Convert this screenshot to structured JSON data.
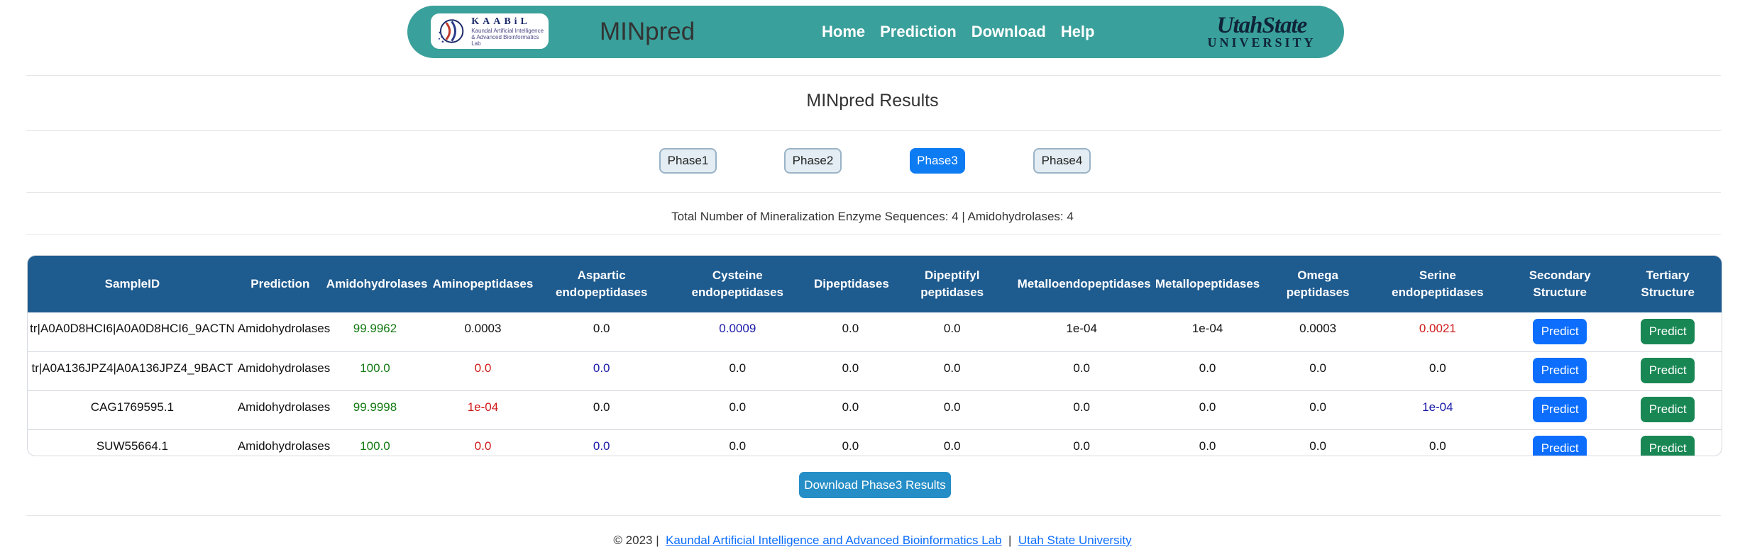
{
  "header": {
    "logo": {
      "title": "KAABiL",
      "subtitle_line1": "Kaundal Artificial Intelligence",
      "subtitle_line2": "& Advanced Bioinformatics Lab"
    },
    "app_title": "MINpred",
    "nav": [
      "Home",
      "Prediction",
      "Download",
      "Help"
    ],
    "university": {
      "top": "UtahState",
      "bottom": "UNIVERSITY"
    }
  },
  "results_title": "MINpred Results",
  "phases": [
    {
      "label": "Phase1",
      "active": false
    },
    {
      "label": "Phase2",
      "active": false
    },
    {
      "label": "Phase3",
      "active": true
    },
    {
      "label": "Phase4",
      "active": false
    }
  ],
  "summary": "Total Number of Mineralization Enzyme Sequences: 4 | Amidohydrolases: 4",
  "table": {
    "headers": [
      [
        "SampleID"
      ],
      [
        "Prediction"
      ],
      [
        "Amidohydrolases"
      ],
      [
        "Aminopeptidases"
      ],
      [
        "Aspartic",
        "endopeptidases"
      ],
      [
        "Cysteine",
        "endopeptidases"
      ],
      [
        "Dipeptidases"
      ],
      [
        "Dipeptifyl",
        "peptidases"
      ],
      [
        "Metalloendopeptidases"
      ],
      [
        "Metallopeptidases"
      ],
      [
        "Omega",
        "peptidases"
      ],
      [
        "Serine",
        "endopeptidases"
      ],
      [
        "Secondary",
        "Structure"
      ],
      [
        "Tertiary",
        "Structure"
      ]
    ],
    "rows": [
      {
        "sample_id": "tr|A0A0D8HCI6|A0A0D8HCI6_9ACTN",
        "prediction": "Amidohydrolases",
        "values": [
          {
            "v": "99.9962",
            "c": "green"
          },
          {
            "v": "0.0003",
            "c": "black"
          },
          {
            "v": "0.0",
            "c": "black"
          },
          {
            "v": "0.0009",
            "c": "blue"
          },
          {
            "v": "0.0",
            "c": "black"
          },
          {
            "v": "0.0",
            "c": "black"
          },
          {
            "v": "1e-04",
            "c": "black"
          },
          {
            "v": "1e-04",
            "c": "black"
          },
          {
            "v": "0.0003",
            "c": "black"
          },
          {
            "v": "0.0021",
            "c": "red"
          }
        ],
        "secondary": "Predict",
        "tertiary": "Predict"
      },
      {
        "sample_id": "tr|A0A136JPZ4|A0A136JPZ4_9BACT",
        "prediction": "Amidohydrolases",
        "values": [
          {
            "v": "100.0",
            "c": "green"
          },
          {
            "v": "0.0",
            "c": "red"
          },
          {
            "v": "0.0",
            "c": "blue"
          },
          {
            "v": "0.0",
            "c": "black"
          },
          {
            "v": "0.0",
            "c": "black"
          },
          {
            "v": "0.0",
            "c": "black"
          },
          {
            "v": "0.0",
            "c": "black"
          },
          {
            "v": "0.0",
            "c": "black"
          },
          {
            "v": "0.0",
            "c": "black"
          },
          {
            "v": "0.0",
            "c": "black"
          }
        ],
        "secondary": "Predict",
        "tertiary": "Predict"
      },
      {
        "sample_id": "CAG1769595.1",
        "prediction": "Amidohydrolases",
        "values": [
          {
            "v": "99.9998",
            "c": "green"
          },
          {
            "v": "1e-04",
            "c": "red"
          },
          {
            "v": "0.0",
            "c": "black"
          },
          {
            "v": "0.0",
            "c": "black"
          },
          {
            "v": "0.0",
            "c": "black"
          },
          {
            "v": "0.0",
            "c": "black"
          },
          {
            "v": "0.0",
            "c": "black"
          },
          {
            "v": "0.0",
            "c": "black"
          },
          {
            "v": "0.0",
            "c": "black"
          },
          {
            "v": "1e-04",
            "c": "blue"
          }
        ],
        "secondary": "Predict",
        "tertiary": "Predict"
      },
      {
        "sample_id": "SUW55664.1",
        "prediction": "Amidohydrolases",
        "values": [
          {
            "v": "100.0",
            "c": "green"
          },
          {
            "v": "0.0",
            "c": "red"
          },
          {
            "v": "0.0",
            "c": "blue"
          },
          {
            "v": "0.0",
            "c": "black"
          },
          {
            "v": "0.0",
            "c": "black"
          },
          {
            "v": "0.0",
            "c": "black"
          },
          {
            "v": "0.0",
            "c": "black"
          },
          {
            "v": "0.0",
            "c": "black"
          },
          {
            "v": "0.0",
            "c": "black"
          },
          {
            "v": "0.0",
            "c": "black"
          }
        ],
        "secondary": "Predict",
        "tertiary": "Predict"
      }
    ]
  },
  "download_button": "Download Phase3 Results",
  "footer": {
    "copyright": "© 2023 |",
    "lab_link": "Kaundal Artificial Intelligence and Advanced Bioinformatics Lab",
    "separator": "|",
    "university_link": "Utah State University"
  },
  "colors": {
    "navbar": "#3aa09b",
    "table_header": "#1e5b8f",
    "phase_active": "#0d7cf2",
    "predict_secondary": "#0d6efd",
    "predict_tertiary": "#198754",
    "download": "#268ec7"
  }
}
